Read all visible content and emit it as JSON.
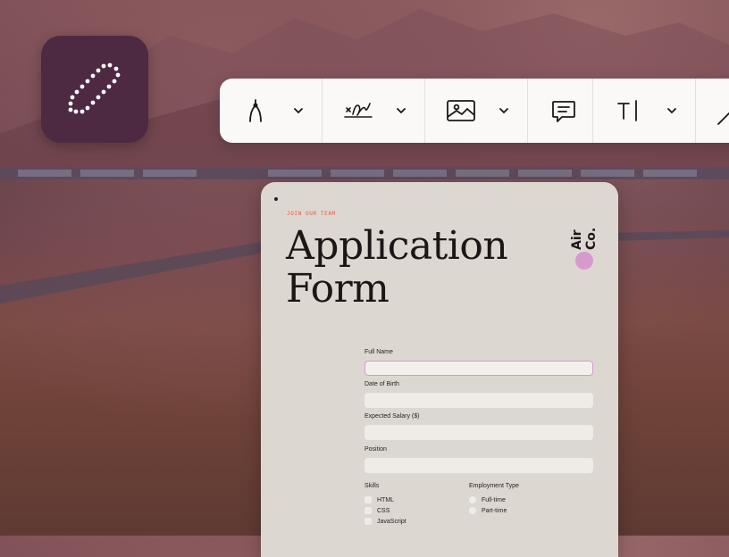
{
  "toolbar": {
    "tools": [
      {
        "name": "pen-tool",
        "has_menu": true
      },
      {
        "name": "signature-tool",
        "has_menu": true
      },
      {
        "name": "image-tool",
        "has_menu": true
      },
      {
        "name": "comment-tool",
        "has_menu": false
      },
      {
        "name": "text-tool",
        "has_menu": true
      },
      {
        "name": "line-tool",
        "has_menu": false
      }
    ]
  },
  "form": {
    "eyebrow": "JOIN OUR TEAM",
    "title_line1": "Application",
    "title_line2": "Form",
    "brand": "Air Co.",
    "fields": [
      {
        "label": "Full Name",
        "value": ""
      },
      {
        "label": "Date of Birth",
        "value": ""
      },
      {
        "label": "Expected Salary ($)",
        "value": ""
      },
      {
        "label": "Position",
        "value": ""
      }
    ],
    "skills": {
      "label": "Skills",
      "options": [
        "HTML",
        "CSS",
        "JavaScript"
      ]
    },
    "employment": {
      "label": "Employment Type",
      "options": [
        "Full-time",
        "Part-time"
      ]
    }
  },
  "colors": {
    "app_icon_bg": "#4e2a42",
    "accent_pink": "#d69bcc",
    "eyebrow": "#e0604e",
    "card_bg": "#ddd7d1"
  }
}
